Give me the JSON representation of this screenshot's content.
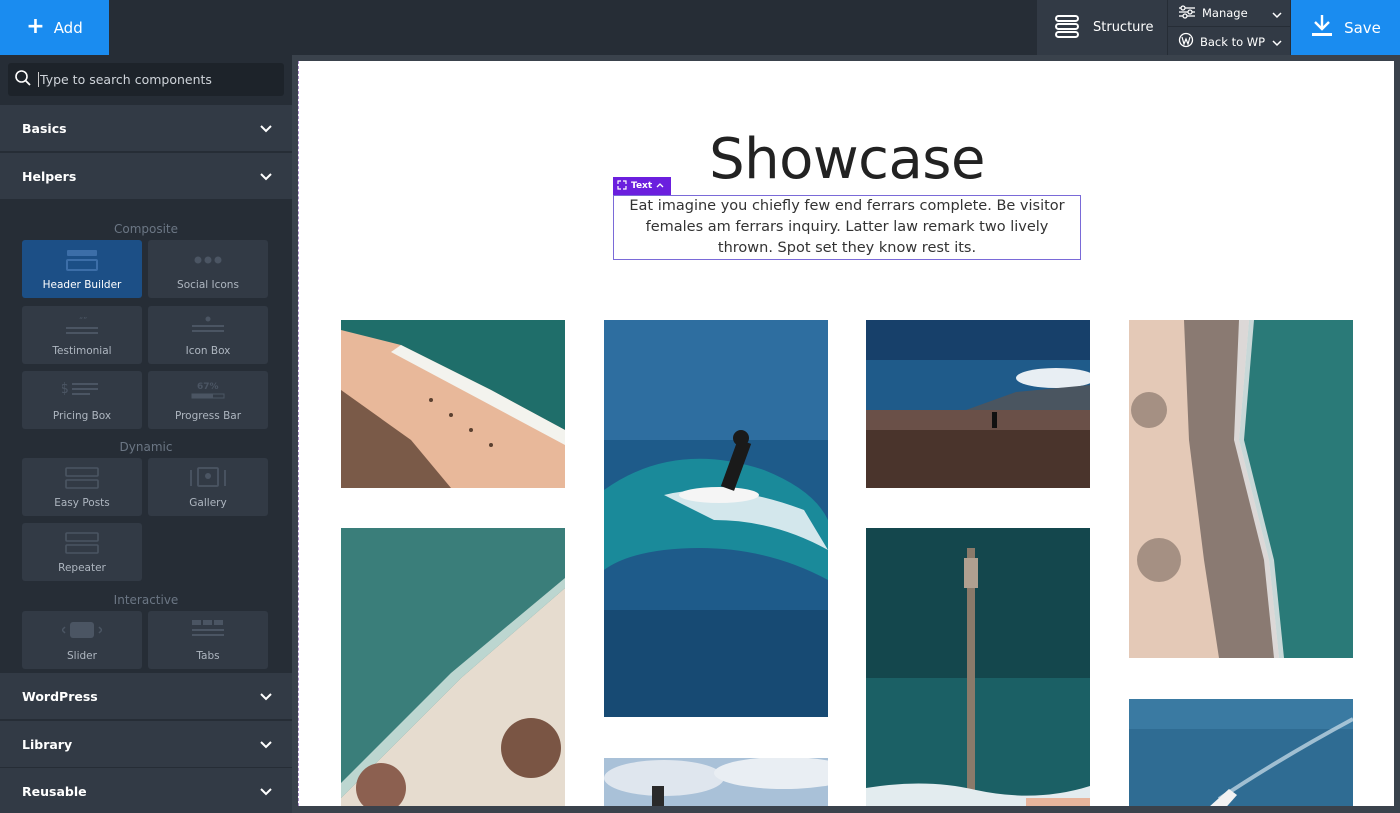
{
  "topbar": {
    "add_label": "Add",
    "structure_label": "Structure",
    "manage_label": "Manage",
    "back_label": "Back to WP",
    "save_label": "Save"
  },
  "sidebar": {
    "search_placeholder": "Type to search components",
    "categories": {
      "basics": "Basics",
      "helpers": "Helpers",
      "wordpress": "WordPress",
      "library": "Library",
      "reusable": "Reusable"
    },
    "groups": {
      "composite": "Composite",
      "dynamic": "Dynamic",
      "interactive": "Interactive"
    },
    "tiles": {
      "header_builder": "Header Builder",
      "social_icons": "Social Icons",
      "testimonial": "Testimonial",
      "icon_box": "Icon Box",
      "pricing_box": "Pricing Box",
      "progress_bar": "Progress Bar",
      "easy_posts": "Easy Posts",
      "gallery": "Gallery",
      "repeater": "Repeater",
      "slider": "Slider",
      "tabs": "Tabs"
    },
    "progress_icon_text": "67%"
  },
  "page": {
    "title": "Showcase",
    "text_tag": "Text",
    "paragraph": "Eat imagine you chiefly few end ferrars complete. Be visitor females am ferrars inquiry. Latter law remark two lively thrown. Spot set they know rest its."
  },
  "colors": {
    "accent": "#1a8cf0",
    "topbar_bg": "#262d36",
    "sidebar_item_bg": "#323a45",
    "active_tile": "#1c4f86",
    "selection": "#6b1fde"
  }
}
